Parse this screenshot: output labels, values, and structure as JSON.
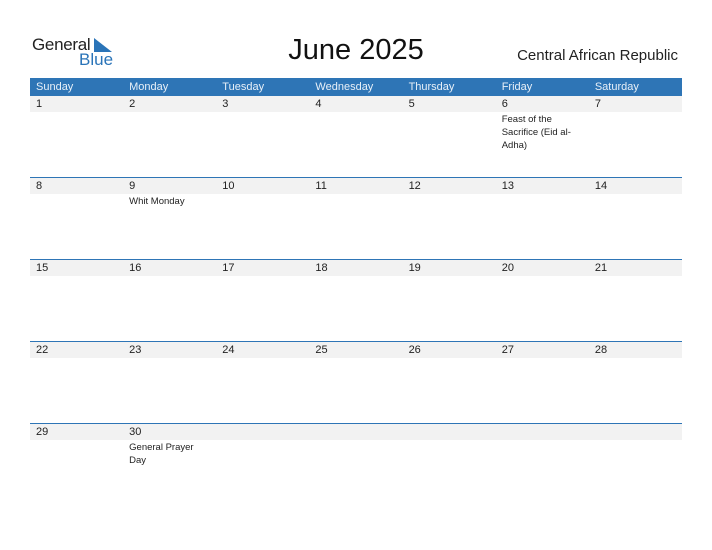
{
  "logo": {
    "word1": "General",
    "word2": "Blue"
  },
  "title": "June 2025",
  "country": "Central African Republic",
  "colors": {
    "accent": "#2e75b6",
    "daybar": "#f2f2f2"
  },
  "weekdays": [
    "Sunday",
    "Monday",
    "Tuesday",
    "Wednesday",
    "Thursday",
    "Friday",
    "Saturday"
  ],
  "weeks": [
    [
      {
        "day": "1",
        "event": ""
      },
      {
        "day": "2",
        "event": ""
      },
      {
        "day": "3",
        "event": ""
      },
      {
        "day": "4",
        "event": ""
      },
      {
        "day": "5",
        "event": ""
      },
      {
        "day": "6",
        "event": "Feast of the Sacrifice (Eid al-Adha)"
      },
      {
        "day": "7",
        "event": ""
      }
    ],
    [
      {
        "day": "8",
        "event": ""
      },
      {
        "day": "9",
        "event": "Whit Monday"
      },
      {
        "day": "10",
        "event": ""
      },
      {
        "day": "11",
        "event": ""
      },
      {
        "day": "12",
        "event": ""
      },
      {
        "day": "13",
        "event": ""
      },
      {
        "day": "14",
        "event": ""
      }
    ],
    [
      {
        "day": "15",
        "event": ""
      },
      {
        "day": "16",
        "event": ""
      },
      {
        "day": "17",
        "event": ""
      },
      {
        "day": "18",
        "event": ""
      },
      {
        "day": "19",
        "event": ""
      },
      {
        "day": "20",
        "event": ""
      },
      {
        "day": "21",
        "event": ""
      }
    ],
    [
      {
        "day": "22",
        "event": ""
      },
      {
        "day": "23",
        "event": ""
      },
      {
        "day": "24",
        "event": ""
      },
      {
        "day": "25",
        "event": ""
      },
      {
        "day": "26",
        "event": ""
      },
      {
        "day": "27",
        "event": ""
      },
      {
        "day": "28",
        "event": ""
      }
    ],
    [
      {
        "day": "29",
        "event": ""
      },
      {
        "day": "30",
        "event": "General Prayer Day"
      },
      {
        "day": "",
        "event": ""
      },
      {
        "day": "",
        "event": ""
      },
      {
        "day": "",
        "event": ""
      },
      {
        "day": "",
        "event": ""
      },
      {
        "day": "",
        "event": ""
      }
    ]
  ]
}
